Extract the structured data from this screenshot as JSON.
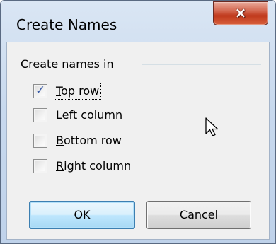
{
  "dialog": {
    "title": "Create Names",
    "close_glyph": "×"
  },
  "group": {
    "label": "Create names in"
  },
  "options": [
    {
      "accel": "T",
      "rest": "op row",
      "checked": true
    },
    {
      "accel": "L",
      "rest": "eft column",
      "checked": false
    },
    {
      "accel": "B",
      "rest": "ottom row",
      "checked": false
    },
    {
      "accel": "R",
      "rest": "ight column",
      "checked": false
    }
  ],
  "buttons": {
    "ok_label": "OK",
    "cancel_label": "Cancel"
  },
  "icons": {
    "check": "check-icon",
    "cursor": "mouse-pointer-icon",
    "close": "close-icon"
  },
  "colors": {
    "check": "#3a5ca8",
    "close_button": "#c0391c",
    "ok_focus_border": "#3c7fb1"
  }
}
